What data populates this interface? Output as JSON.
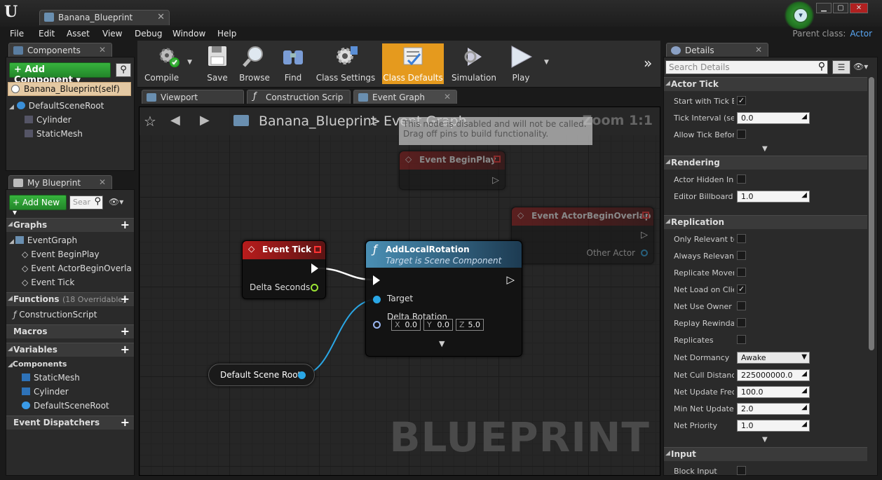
{
  "window": {
    "tab_title": "Banana_Blueprint",
    "parent_class_label": "Parent class:",
    "parent_class_value": "Actor"
  },
  "menu": [
    "File",
    "Edit",
    "Asset",
    "View",
    "Debug",
    "Window",
    "Help"
  ],
  "components_panel": {
    "title": "Components",
    "add_button": "+ Add Component ▾",
    "self_item": "Banana_Blueprint(self)",
    "tree": [
      "DefaultSceneRoot",
      "Cylinder",
      "StaticMesh"
    ]
  },
  "my_blueprint_panel": {
    "title": "My Blueprint",
    "add_new": "+ Add New ▾",
    "search_placeholder": "Sear",
    "sections": {
      "graphs": "Graphs",
      "functions": "Functions",
      "functions_count": "(18 Overridable)",
      "macros": "Macros",
      "variables": "Variables",
      "components": "Components",
      "event_dispatchers": "Event Dispatchers"
    },
    "graph_items": [
      "EventGraph",
      "Event BeginPlay",
      "Event ActorBeginOverla",
      "Event Tick"
    ],
    "function_items": [
      "ConstructionScript"
    ],
    "component_vars": [
      "StaticMesh",
      "Cylinder",
      "DefaultSceneRoot"
    ]
  },
  "toolbar": {
    "compile": "Compile",
    "save": "Save",
    "browse": "Browse",
    "find": "Find",
    "class_settings": "Class Settings",
    "class_defaults": "Class Defaults",
    "simulation": "Simulation",
    "play": "Play",
    "overflow": "»"
  },
  "editor_tabs": [
    "Viewport",
    "Construction Scrip",
    "Event Graph"
  ],
  "graph": {
    "breadcrumb_root": "Banana_Blueprint",
    "breadcrumb_sep": ">",
    "breadcrumb_current": "Event Graph",
    "zoom": "Zoom 1:1",
    "watermark": "BLUEPRINT",
    "disabled_note_l1": "This node is disabled and will not be called.",
    "disabled_note_l2": "Drag off pins to build functionality.",
    "nodes": {
      "begin_play": "Event BeginPlay",
      "actor_overlap": "Event ActorBeginOverlap",
      "actor_overlap_pin": "Other Actor",
      "tick": "Event Tick",
      "tick_pin": "Delta Seconds",
      "add_rot": "AddLocalRotation",
      "add_rot_sub": "Target is Scene Component",
      "add_rot_target": "Target",
      "add_rot_delta": "Delta Rotation",
      "x_label": "X",
      "x_value": "0.0",
      "y_label": "Y",
      "y_value": "0.0",
      "z_label": "Z",
      "z_value": "5.0",
      "scene_root": "Default Scene Root"
    }
  },
  "details": {
    "title": "Details",
    "search_placeholder": "Search Details",
    "actor_tick": {
      "header": "Actor Tick",
      "start_with_tick": "Start with Tick Er",
      "tick_interval": "Tick Interval (sec",
      "tick_interval_value": "0.0",
      "allow_tick_before": "Allow Tick Before"
    },
    "rendering": {
      "header": "Rendering",
      "actor_hidden": "Actor Hidden In G",
      "editor_billboard": "Editor Billboard S",
      "editor_billboard_value": "1.0"
    },
    "replication": {
      "header": "Replication",
      "only_relevant": "Only Relevant to",
      "always_relevant": "Always Relevant",
      "replicate_movement": "Replicate Movem",
      "net_load": "Net Load on Clier",
      "net_use_owner": "Net Use Owner R",
      "replay_rewindable": "Replay Rewindab",
      "replicates": "Replicates",
      "net_dormancy": "Net Dormancy",
      "net_dormancy_value": "Awake",
      "net_cull": "Net Cull Distance",
      "net_cull_value": "225000000.0",
      "net_update_freq": "Net Update Frequ",
      "net_update_freq_value": "100.0",
      "min_net_update": "Min Net Update F",
      "min_net_update_value": "2.0",
      "net_priority": "Net Priority",
      "net_priority_value": "1.0"
    },
    "input": {
      "header": "Input",
      "block_input": "Block Input"
    }
  }
}
